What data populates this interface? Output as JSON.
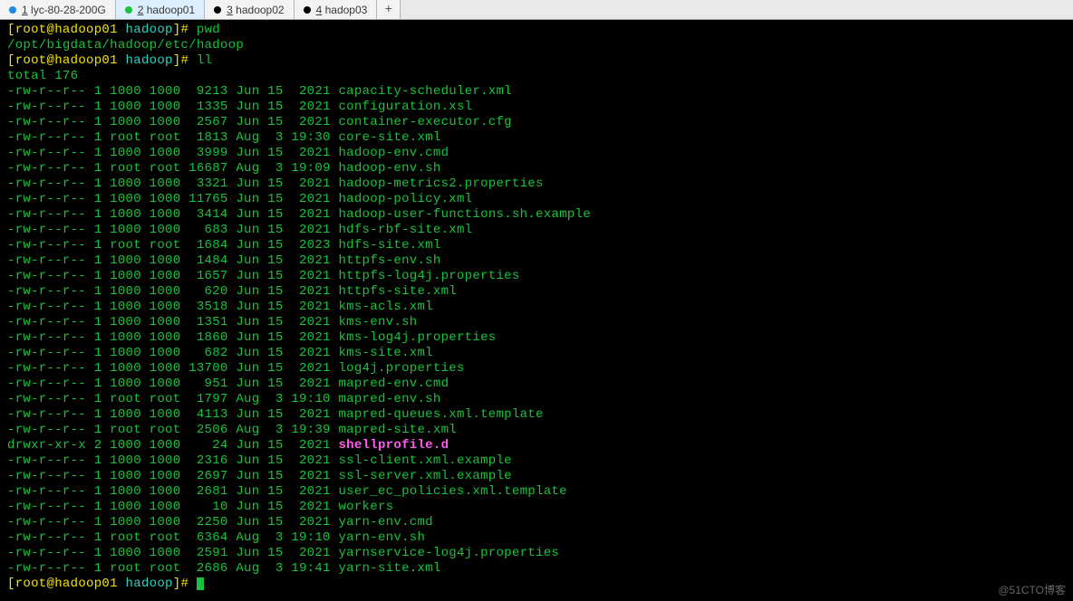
{
  "tabs": [
    {
      "num": "1",
      "label": "lyc-80-28-200G",
      "dot": "dot-blue",
      "active": false
    },
    {
      "num": "2",
      "label": "hadoop01",
      "dot": "dot-green",
      "active": true
    },
    {
      "num": "3",
      "label": "hadoop02",
      "dot": "dot-black",
      "active": false
    },
    {
      "num": "4",
      "label": "hadop03",
      "dot": "dot-black",
      "active": false
    }
  ],
  "tab_add": "+",
  "prompt": {
    "user": "root",
    "host": "hadoop01",
    "dir": "hadoop",
    "open": "[",
    "at": "@",
    "close": "]#",
    "cmd1": "pwd",
    "cmd2": "ll",
    "cwd": "/opt/bigdata/hadoop/etc/hadoop"
  },
  "total": "total 176",
  "files": [
    {
      "perm": "-rw-r--r--",
      "ln": "1",
      "own": "1000",
      "grp": "1000",
      "size": "9213",
      "mon": "Jun",
      "day": "15",
      "yrtm": "2021",
      "name": "capacity-scheduler.xml"
    },
    {
      "perm": "-rw-r--r--",
      "ln": "1",
      "own": "1000",
      "grp": "1000",
      "size": "1335",
      "mon": "Jun",
      "day": "15",
      "yrtm": "2021",
      "name": "configuration.xsl"
    },
    {
      "perm": "-rw-r--r--",
      "ln": "1",
      "own": "1000",
      "grp": "1000",
      "size": "2567",
      "mon": "Jun",
      "day": "15",
      "yrtm": "2021",
      "name": "container-executor.cfg"
    },
    {
      "perm": "-rw-r--r--",
      "ln": "1",
      "own": "root",
      "grp": "root",
      "size": "1813",
      "mon": "Aug",
      "day": "3",
      "yrtm": "19:30",
      "name": "core-site.xml"
    },
    {
      "perm": "-rw-r--r--",
      "ln": "1",
      "own": "1000",
      "grp": "1000",
      "size": "3999",
      "mon": "Jun",
      "day": "15",
      "yrtm": "2021",
      "name": "hadoop-env.cmd"
    },
    {
      "perm": "-rw-r--r--",
      "ln": "1",
      "own": "root",
      "grp": "root",
      "size": "16687",
      "mon": "Aug",
      "day": "3",
      "yrtm": "19:09",
      "name": "hadoop-env.sh"
    },
    {
      "perm": "-rw-r--r--",
      "ln": "1",
      "own": "1000",
      "grp": "1000",
      "size": "3321",
      "mon": "Jun",
      "day": "15",
      "yrtm": "2021",
      "name": "hadoop-metrics2.properties"
    },
    {
      "perm": "-rw-r--r--",
      "ln": "1",
      "own": "1000",
      "grp": "1000",
      "size": "11765",
      "mon": "Jun",
      "day": "15",
      "yrtm": "2021",
      "name": "hadoop-policy.xml"
    },
    {
      "perm": "-rw-r--r--",
      "ln": "1",
      "own": "1000",
      "grp": "1000",
      "size": "3414",
      "mon": "Jun",
      "day": "15",
      "yrtm": "2021",
      "name": "hadoop-user-functions.sh.example"
    },
    {
      "perm": "-rw-r--r--",
      "ln": "1",
      "own": "1000",
      "grp": "1000",
      "size": "683",
      "mon": "Jun",
      "day": "15",
      "yrtm": "2021",
      "name": "hdfs-rbf-site.xml"
    },
    {
      "perm": "-rw-r--r--",
      "ln": "1",
      "own": "root",
      "grp": "root",
      "size": "1684",
      "mon": "Jun",
      "day": "15",
      "yrtm": "2023",
      "name": "hdfs-site.xml"
    },
    {
      "perm": "-rw-r--r--",
      "ln": "1",
      "own": "1000",
      "grp": "1000",
      "size": "1484",
      "mon": "Jun",
      "day": "15",
      "yrtm": "2021",
      "name": "httpfs-env.sh"
    },
    {
      "perm": "-rw-r--r--",
      "ln": "1",
      "own": "1000",
      "grp": "1000",
      "size": "1657",
      "mon": "Jun",
      "day": "15",
      "yrtm": "2021",
      "name": "httpfs-log4j.properties"
    },
    {
      "perm": "-rw-r--r--",
      "ln": "1",
      "own": "1000",
      "grp": "1000",
      "size": "620",
      "mon": "Jun",
      "day": "15",
      "yrtm": "2021",
      "name": "httpfs-site.xml"
    },
    {
      "perm": "-rw-r--r--",
      "ln": "1",
      "own": "1000",
      "grp": "1000",
      "size": "3518",
      "mon": "Jun",
      "day": "15",
      "yrtm": "2021",
      "name": "kms-acls.xml"
    },
    {
      "perm": "-rw-r--r--",
      "ln": "1",
      "own": "1000",
      "grp": "1000",
      "size": "1351",
      "mon": "Jun",
      "day": "15",
      "yrtm": "2021",
      "name": "kms-env.sh"
    },
    {
      "perm": "-rw-r--r--",
      "ln": "1",
      "own": "1000",
      "grp": "1000",
      "size": "1860",
      "mon": "Jun",
      "day": "15",
      "yrtm": "2021",
      "name": "kms-log4j.properties"
    },
    {
      "perm": "-rw-r--r--",
      "ln": "1",
      "own": "1000",
      "grp": "1000",
      "size": "682",
      "mon": "Jun",
      "day": "15",
      "yrtm": "2021",
      "name": "kms-site.xml"
    },
    {
      "perm": "-rw-r--r--",
      "ln": "1",
      "own": "1000",
      "grp": "1000",
      "size": "13700",
      "mon": "Jun",
      "day": "15",
      "yrtm": "2021",
      "name": "log4j.properties"
    },
    {
      "perm": "-rw-r--r--",
      "ln": "1",
      "own": "1000",
      "grp": "1000",
      "size": "951",
      "mon": "Jun",
      "day": "15",
      "yrtm": "2021",
      "name": "mapred-env.cmd"
    },
    {
      "perm": "-rw-r--r--",
      "ln": "1",
      "own": "root",
      "grp": "root",
      "size": "1797",
      "mon": "Aug",
      "day": "3",
      "yrtm": "19:10",
      "name": "mapred-env.sh"
    },
    {
      "perm": "-rw-r--r--",
      "ln": "1",
      "own": "1000",
      "grp": "1000",
      "size": "4113",
      "mon": "Jun",
      "day": "15",
      "yrtm": "2021",
      "name": "mapred-queues.xml.template"
    },
    {
      "perm": "-rw-r--r--",
      "ln": "1",
      "own": "root",
      "grp": "root",
      "size": "2506",
      "mon": "Aug",
      "day": "3",
      "yrtm": "19:39",
      "name": "mapred-site.xml"
    },
    {
      "perm": "drwxr-xr-x",
      "ln": "2",
      "own": "1000",
      "grp": "1000",
      "size": "24",
      "mon": "Jun",
      "day": "15",
      "yrtm": "2021",
      "name": "shellprofile.d",
      "dir": true
    },
    {
      "perm": "-rw-r--r--",
      "ln": "1",
      "own": "1000",
      "grp": "1000",
      "size": "2316",
      "mon": "Jun",
      "day": "15",
      "yrtm": "2021",
      "name": "ssl-client.xml.example"
    },
    {
      "perm": "-rw-r--r--",
      "ln": "1",
      "own": "1000",
      "grp": "1000",
      "size": "2697",
      "mon": "Jun",
      "day": "15",
      "yrtm": "2021",
      "name": "ssl-server.xml.example"
    },
    {
      "perm": "-rw-r--r--",
      "ln": "1",
      "own": "1000",
      "grp": "1000",
      "size": "2681",
      "mon": "Jun",
      "day": "15",
      "yrtm": "2021",
      "name": "user_ec_policies.xml.template"
    },
    {
      "perm": "-rw-r--r--",
      "ln": "1",
      "own": "1000",
      "grp": "1000",
      "size": "10",
      "mon": "Jun",
      "day": "15",
      "yrtm": "2021",
      "name": "workers"
    },
    {
      "perm": "-rw-r--r--",
      "ln": "1",
      "own": "1000",
      "grp": "1000",
      "size": "2250",
      "mon": "Jun",
      "day": "15",
      "yrtm": "2021",
      "name": "yarn-env.cmd"
    },
    {
      "perm": "-rw-r--r--",
      "ln": "1",
      "own": "root",
      "grp": "root",
      "size": "6364",
      "mon": "Aug",
      "day": "3",
      "yrtm": "19:10",
      "name": "yarn-env.sh"
    },
    {
      "perm": "-rw-r--r--",
      "ln": "1",
      "own": "1000",
      "grp": "1000",
      "size": "2591",
      "mon": "Jun",
      "day": "15",
      "yrtm": "2021",
      "name": "yarnservice-log4j.properties"
    },
    {
      "perm": "-rw-r--r--",
      "ln": "1",
      "own": "root",
      "grp": "root",
      "size": "2686",
      "mon": "Aug",
      "day": "3",
      "yrtm": "19:41",
      "name": "yarn-site.xml"
    }
  ],
  "watermark": "@51CTO博客"
}
